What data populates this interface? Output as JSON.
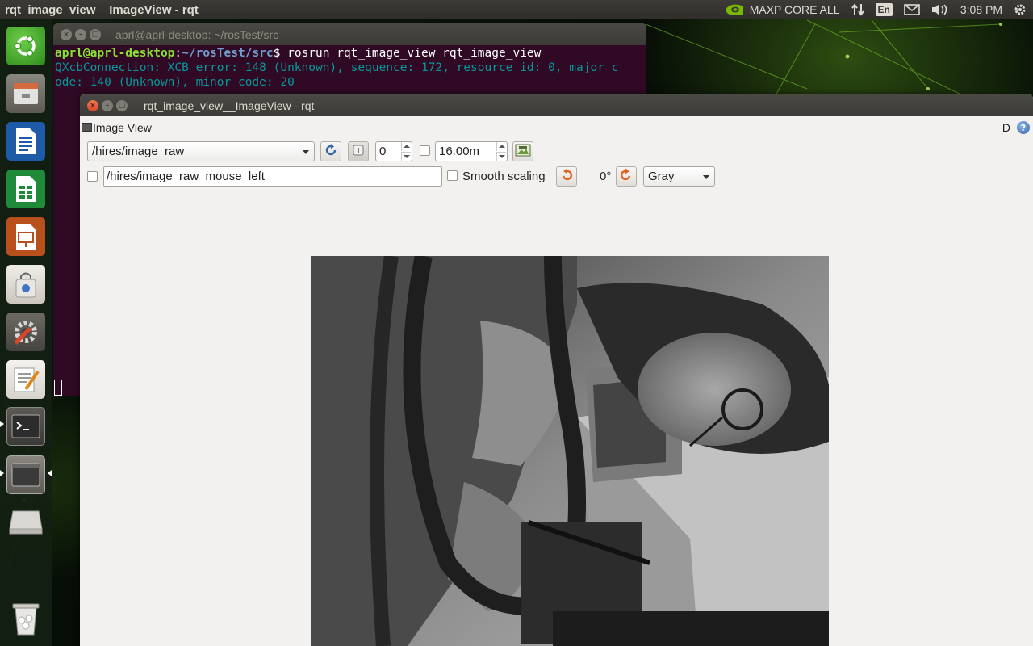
{
  "top_panel": {
    "window_title": "rqt_image_view__ImageView - rqt",
    "indicator_label": "MAXP CORE ALL",
    "keyboard_layout": "En",
    "clock": "3:08 PM",
    "icons": [
      "nvidia-icon",
      "network-icon",
      "mail-icon",
      "volume-icon",
      "settings-gear-icon"
    ]
  },
  "launcher": {
    "items": [
      {
        "name": "ubuntu-dash",
        "icon": "ubuntu-logo-icon"
      },
      {
        "name": "files",
        "icon": "file-manager-icon"
      },
      {
        "name": "writer",
        "icon": "libreoffice-writer-icon"
      },
      {
        "name": "calc",
        "icon": "libreoffice-calc-icon"
      },
      {
        "name": "impress",
        "icon": "libreoffice-impress-icon"
      },
      {
        "name": "software-center",
        "icon": "shopping-bag-icon"
      },
      {
        "name": "system-settings",
        "icon": "settings-wrench-icon"
      },
      {
        "name": "text-editor",
        "icon": "text-editor-icon"
      },
      {
        "name": "terminal",
        "icon": "terminal-icon"
      },
      {
        "name": "rqt-window",
        "icon": "window-icon"
      },
      {
        "name": "drive",
        "icon": "drive-icon"
      },
      {
        "name": "trash",
        "icon": "trash-icon"
      }
    ]
  },
  "terminal": {
    "title": "aprl@aprl-desktop: ~/rosTest/src",
    "prompt_user": "aprl@aprl-desktop",
    "prompt_sep": ":",
    "prompt_path": "~/rosTest/src",
    "prompt_dollar": "$ ",
    "command": "rosrun rqt_image_view rqt_image_view",
    "error_line1": "QXcbConnection: XCB error: 148 (Unknown), sequence: 172, resource id: 0, major c",
    "error_line2": "ode: 140 (Unknown), minor code: 20"
  },
  "rqt": {
    "title": "rqt_image_view__ImageView - rqt",
    "dock_title": "Image View",
    "dock_d": "D",
    "help_glyph": "?",
    "close_glyph": "×",
    "min_glyph": "–",
    "max_glyph": "□",
    "topic": "/hires/image_raw",
    "spin_value": "0",
    "rate_value": "16.00m",
    "mouse_topic": "/hires/image_raw_mouse_left",
    "smooth_scaling_label": "Smooth scaling",
    "rotation_label": "0°",
    "color_scheme": "Gray",
    "smooth_scaling_checked": false,
    "publish_mouse_checked": false
  }
}
